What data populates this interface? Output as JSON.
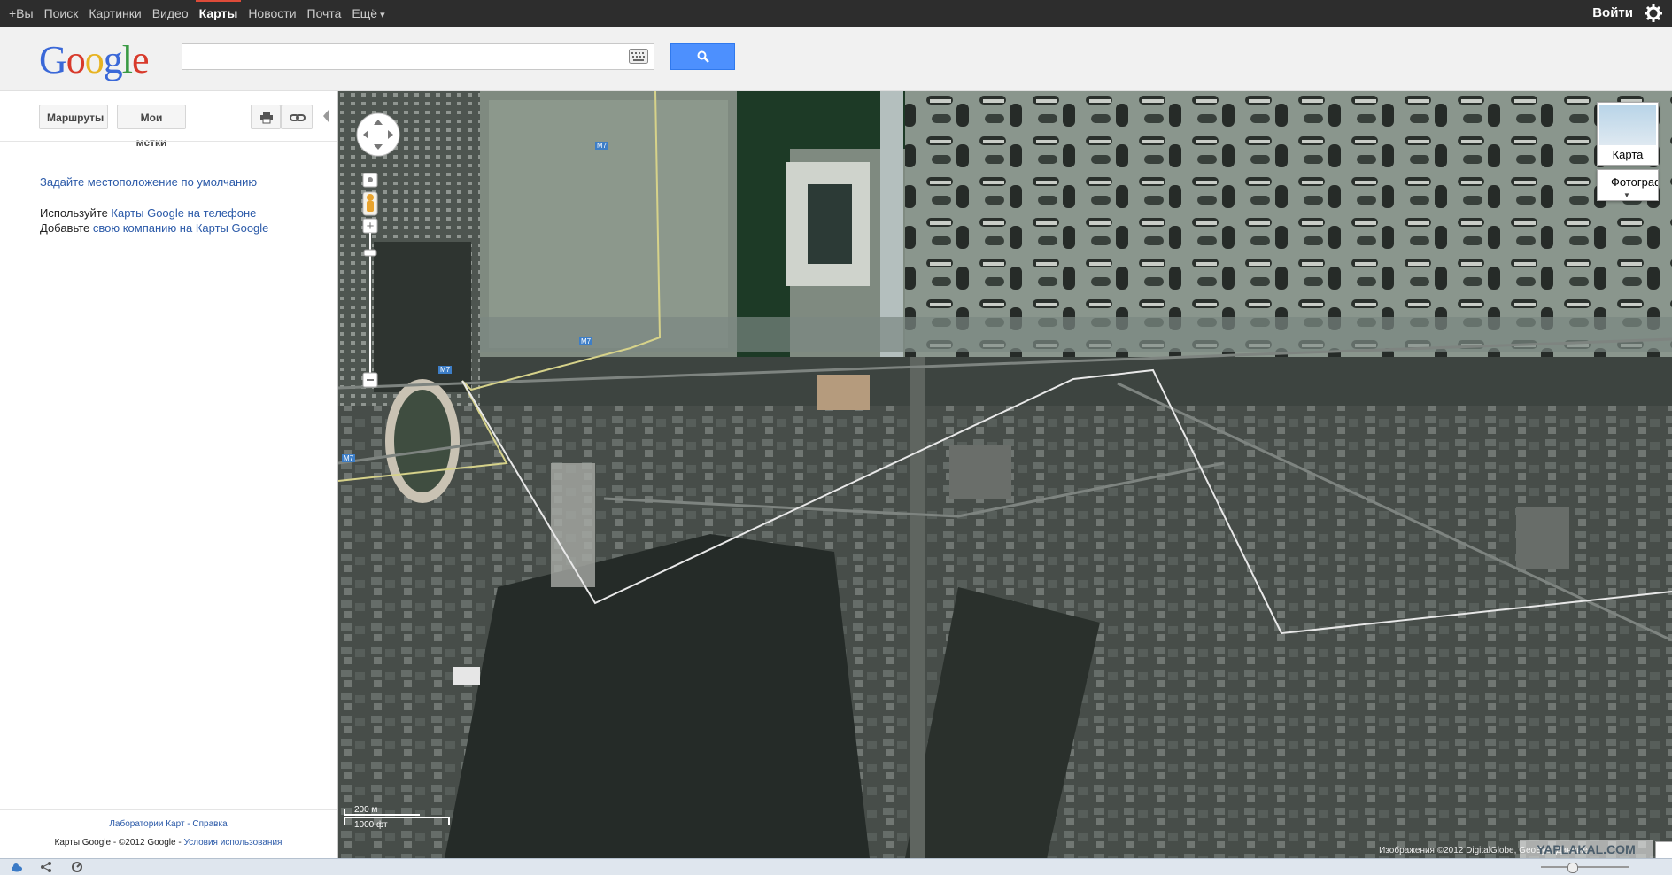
{
  "topbar": {
    "nav": [
      "+Вы",
      "Поиск",
      "Картинки",
      "Видео",
      "Карты",
      "Новости",
      "Почта",
      "Ещё"
    ],
    "active": "Карты",
    "login": "Войти"
  },
  "header": {
    "logo": [
      "G",
      "o",
      "o",
      "g",
      "l",
      "e"
    ],
    "search_value": "",
    "search_placeholder": ""
  },
  "panel": {
    "routes_button": "Маршруты",
    "places_button": "Мои метки",
    "set_location": "Задайте местоположение по умолчанию",
    "line1_prefix": "Используйте ",
    "line1_link": "Карты Google на телефоне",
    "line2_prefix": "Добавьте ",
    "line2_link": "свою компанию на Карты Google",
    "footer_links": "Лаборатории Карт - Справка",
    "footer_copyright": "Карты Google - ©2012 Google - ",
    "footer_terms": "Условия использования"
  },
  "map": {
    "mode_map": "Карта",
    "mode_photo": "Фотограф",
    "scale_metric": "200 м",
    "scale_imperial": "1000 фт",
    "road_labels": [
      "M7",
      "M7",
      "M7",
      "M7"
    ],
    "copyright": "Изображения ©2012 DigitalGlobe, GeoEye, Данные",
    "watermark": "YAPLAKAL.COM"
  },
  "colors": {
    "accent_red": "#dd4b39",
    "search_blue": "#4d90fe",
    "link_blue": "#2a59a8"
  }
}
